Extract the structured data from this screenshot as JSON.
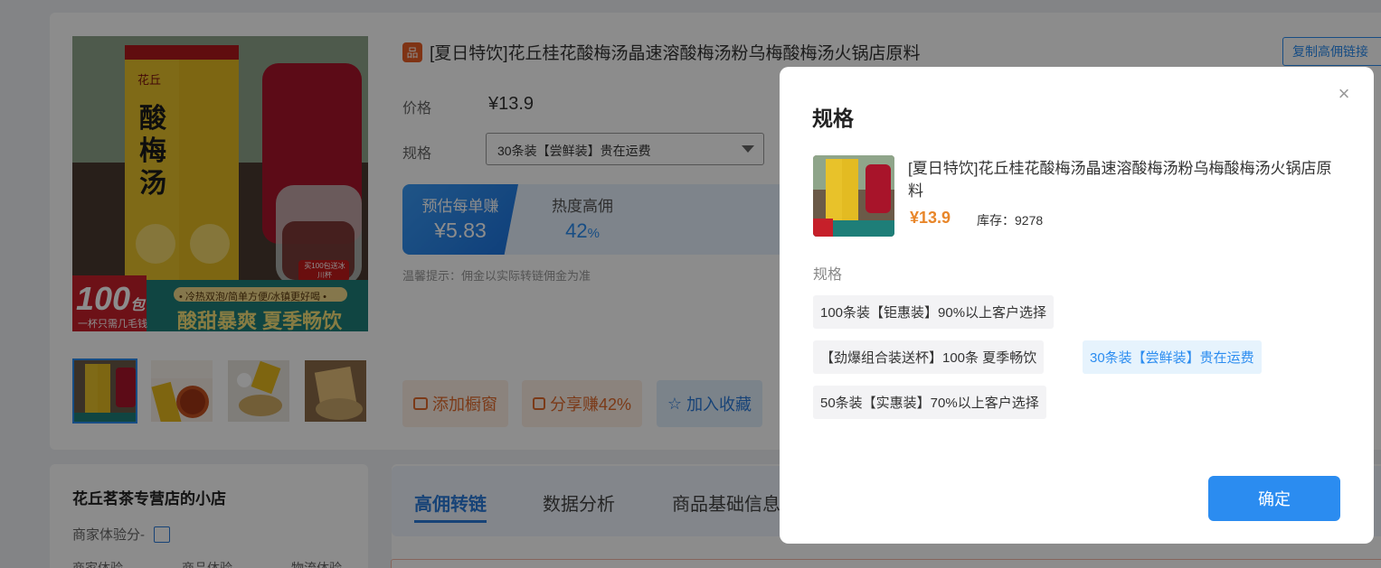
{
  "product": {
    "shop_badge": "品",
    "title": "[夏日特饮]花丘桂花酸梅汤晶速溶酸梅汤粉乌梅酸梅汤火锅店原料",
    "copy_link_label": "复制高佣链接",
    "price_label": "价格",
    "price": "¥13.9",
    "spec_label": "规格",
    "spec_selected": "30条装【尝鲜装】贵在运费",
    "earn_label": "预估每单赚",
    "earn_value": "¥5.83",
    "hot_label": "热度高佣",
    "hot_value": "42",
    "hot_unit": "%",
    "tip": "温馨提示：佣金以实际转链佣金为准",
    "image_texts": {
      "brand": "花丘",
      "product_name": "酸梅汤",
      "big_count": "100",
      "count_unit": "包",
      "per_cup": "一杯只需几毛钱",
      "slogan_small": "• 冷热双泡/简单方便/冰镇更好喝 •",
      "slogan_big": "酸甜暴爽 夏季畅饮",
      "sticker": "买100包送冰川杯"
    },
    "actions": {
      "add_window": "添加橱窗",
      "share": "分享赚42%",
      "favorite": "加入收藏"
    }
  },
  "shop": {
    "name": "花丘茗茶专营店的小店",
    "score_label": "商家体验分-",
    "sub_labels": [
      "商家体验",
      "商品体验",
      "物流体验"
    ]
  },
  "tabs": [
    "高佣转链",
    "数据分析",
    "商品基础信息"
  ],
  "modal": {
    "title": "规格",
    "close": "×",
    "product_title": "[夏日特饮]花丘桂花酸梅汤晶速溶酸梅汤粉乌梅酸梅汤火锅店原料",
    "price": "¥13.9",
    "stock": "库存：9278",
    "spec_label": "规格",
    "options": [
      "100条装【钜惠装】90%以上客户选择",
      "【劲爆组合装送杯】100条 夏季畅饮",
      "30条装【尝鲜装】贵在运费",
      "50条装【实惠装】70%以上客户选择"
    ],
    "selected_option": "30条装【尝鲜装】贵在运费",
    "confirm": "确定"
  },
  "colors": {
    "accent": "#2b8cf0",
    "price_orange": "#e8862a",
    "badge_orange": "#e85d25"
  }
}
